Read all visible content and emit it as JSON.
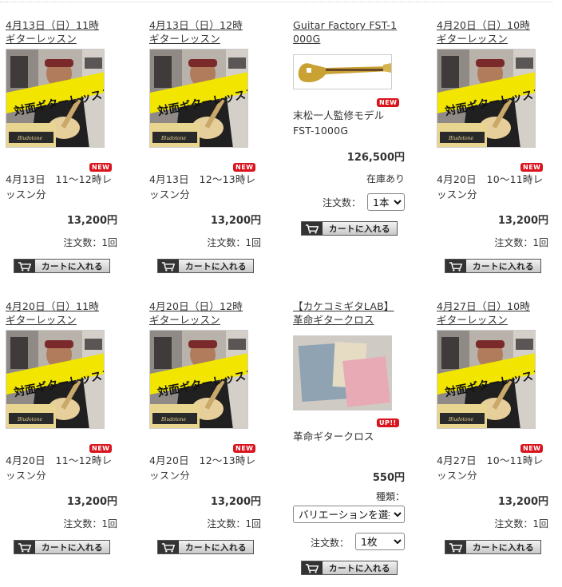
{
  "colors": {
    "badge_red": "#d9141d",
    "text": "#333333"
  },
  "lesson_photo": {
    "overlay_text": "対面ギターレッスン",
    "amp_brand": "Bludotone"
  },
  "cart_label": "カートに入れる",
  "products": [
    {
      "title": "4月13日（日）11時\nギターレッスン",
      "badge": "NEW",
      "desc": "4月13日　11〜12時レ\nッスン分",
      "price": "13,200円",
      "qty": "注文数：1回"
    },
    {
      "title": "4月13日（日）12時\nギターレッスン",
      "badge": "NEW",
      "desc": "4月13日　12〜13時レ\nッスン分",
      "price": "13,200円",
      "qty": "注文数：1回"
    },
    {
      "title": "Guitar Factory FST-1\n000G",
      "badge": "NEW",
      "desc": "末松一人監修モデル\nFST-1000G",
      "price": "126,500円",
      "stock": "在庫あり",
      "qty_label": "注文数：",
      "qty_value": "1本"
    },
    {
      "title": "4月20日（日）10時\nギターレッスン",
      "badge": "NEW",
      "desc": "4月20日　10〜11時レ\nッスン分",
      "price": "13,200円",
      "qty": "注文数：1回"
    },
    {
      "title": "4月20日（日）11時\nギターレッスン",
      "badge": "NEW",
      "desc": "4月20日　11〜12時レ\nッスン分",
      "price": "13,200円",
      "qty": "注文数：1回"
    },
    {
      "title": "4月20日（日）12時\nギターレッスン",
      "badge": "NEW",
      "desc": "4月20日　12〜13時レ\nッスン分",
      "price": "13,200円",
      "qty": "注文数：1回"
    },
    {
      "title": "【カケコミギタLAB】\n革命ギタークロス",
      "badge": "UP!!",
      "desc": "革命ギタークロス",
      "price": "550円",
      "variant_label": "種類：",
      "variant_value": "バリエーションを選択",
      "qty_label": "注文数：",
      "qty_value": "1枚"
    },
    {
      "title": "4月27日（日）10時\nギターレッスン",
      "badge": "NEW",
      "desc": "4月27日　10〜11時レ\nッスン分",
      "price": "13,200円",
      "qty": "注文数：1回"
    }
  ]
}
